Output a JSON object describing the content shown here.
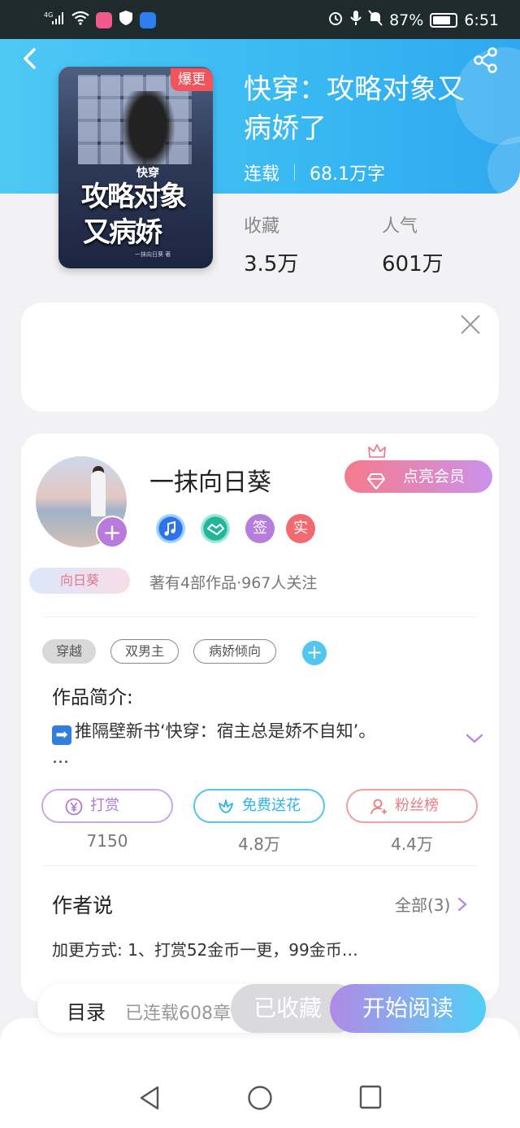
{
  "status_bar": {
    "network": "4G",
    "battery": "87%",
    "time": "6:51"
  },
  "book": {
    "cover_tag": "爆更",
    "cover_text_small": "快穿",
    "cover_text_line1": "攻略对象",
    "cover_text_line2": "又病娇",
    "cover_author_small": "一抹向日葵 著",
    "title": "快穿：攻略对象又病娇了",
    "status": "连载",
    "word_count": "68.1万字",
    "stats": [
      {
        "label": "收藏",
        "value": "3.5万"
      },
      {
        "label": "人气",
        "value": "601万"
      }
    ]
  },
  "author": {
    "name": "一抹向日葵",
    "vip_label": "点亮会员",
    "badge_tag": "向日葵",
    "medals": [
      {
        "icon": "music-medal-icon",
        "text": "",
        "color": "#3d8cf0"
      },
      {
        "icon": "handshake-medal-icon",
        "text": "",
        "color": "#3fc3a6"
      },
      {
        "icon": "sign-medal-icon",
        "text": "签",
        "color": "#b67ddc"
      },
      {
        "icon": "verified-medal-icon",
        "text": "实",
        "color": "#f06a70"
      }
    ],
    "works_info": "著有4部作品·967人关注"
  },
  "tags": [
    "穿越",
    "双男主",
    "病娇倾向"
  ],
  "intro": {
    "heading": "作品简介:",
    "text": "推隔壁新书‘快穿：宿主总是娇不自知’。",
    "ellipsis": "…"
  },
  "actions": [
    {
      "label": "打赏",
      "count": "7150",
      "color": "#c8a0e6",
      "icon": "yen-icon"
    },
    {
      "label": "免费送花",
      "count": "4.8万",
      "color": "#52c6ef",
      "icon": "flower-icon"
    },
    {
      "label": "粉丝榜",
      "count": "4.4万",
      "color": "#f08a8a",
      "icon": "fans-icon"
    }
  ],
  "author_says": {
    "heading": "作者说",
    "all_label": "全部(3)",
    "text": "加更方式: 1、打赏52金币一更，99金币…"
  },
  "bottom": {
    "toc": "目录",
    "serial": "已连载608章",
    "favorited": "已收藏",
    "read": "开始阅读"
  },
  "colors": {
    "header_blue": "#38b8f2",
    "accent_purple": "#b87bdc",
    "hot_red": "#f2545b"
  }
}
